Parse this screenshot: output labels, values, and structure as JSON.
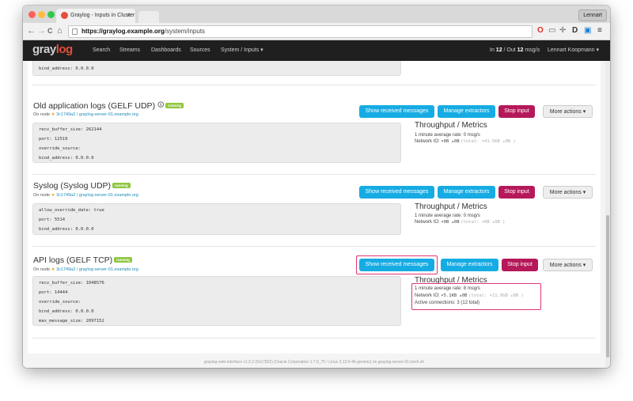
{
  "browser": {
    "tab_title": "Graylog - Inputs in Cluster",
    "tab_close": "×",
    "user_button": "Lennart",
    "url_host": "https://graylog.example.org",
    "url_path": "/system/inputs",
    "back": "←",
    "forward": "→",
    "reload": "C",
    "home": "⌂"
  },
  "navbar": {
    "logo_a": "gray",
    "logo_b": "log",
    "items": [
      "Search",
      "Streams",
      "Dashboards",
      "Sources",
      "System / Inputs ▾"
    ],
    "throughput_prefix": "In ",
    "throughput_in": "12",
    "throughput_mid": " / Out ",
    "throughput_out": "12",
    "throughput_suffix": " msg/s",
    "user": "Lennart Koopmann ▾"
  },
  "top_partial": {
    "line": "bind_address: 0.0.0.0"
  },
  "actions": {
    "show_received": "Show received messages",
    "manage_extractors": "Manage extractors",
    "stop_input": "Stop input",
    "more_actions": "More actions ▾"
  },
  "inputs": [
    {
      "title": "Old application logs (GELF UDP)",
      "badge": "running",
      "node_prefix": "On node ",
      "node_star": "★",
      "node_link": "3c1749a2 / graylog-server-01.example.org",
      "config": [
        "recv_buffer_size: 262144",
        "port: 12519",
        "override_source:",
        "bind_address: 0.0.0.0"
      ],
      "metrics_title": "Throughput / Metrics",
      "rate": "1 minute average rate: 0 msg/s",
      "netio_label": "Network IO: ",
      "netio_value": "▾0B ▴0B",
      "netio_total": "(total: ▾41.5KB ▴0B )"
    },
    {
      "title": "Syslog (Syslog UDP)",
      "badge": "running",
      "node_prefix": "On node ",
      "node_star": "★",
      "node_link": "3c1749a2 / graylog-server-01.example.org",
      "config": [
        "allow_override_date: true",
        "port: 5514",
        "bind_address: 0.0.0.0"
      ],
      "metrics_title": "Throughput / Metrics",
      "rate": "1 minute average rate: 0 msg/s",
      "netio_label": "Network IO: ",
      "netio_value": "▾0B ▴0B",
      "netio_total": "(total: ▾0B ▴0B )"
    },
    {
      "title": "API logs (GELF TCP)",
      "badge": "running",
      "node_prefix": "On node ",
      "node_star": "★",
      "node_link": "3c1749a2 / graylog-server-01.example.org",
      "config": [
        "recv_buffer_size: 1048576",
        "port: 14444",
        "override_source:",
        "bind_address: 0.0.0.0",
        "max_message_size: 2097152"
      ],
      "metrics_title": "Throughput / Metrics",
      "rate": "1 minute average rate: 8 msg/s",
      "netio_label": "Network IO: ",
      "netio_value": "▾5.1KB ▴0B",
      "netio_total": "(total: ▾11.9GB ▴0B )",
      "connections": "Active connections: 3 (12 total)"
    }
  ],
  "footer": "graylog-web-interface v1.2.2 (91c7822) (Oracle Corporation 1.7.0_75 / Linux 3.13.0-46-generic) on graylog-server-01.torch.sh",
  "colors": {
    "accent_blue": "#16ace3",
    "stop_red": "#b5195a",
    "running_green": "#8ec63f",
    "highlight_pink": "#e0357a"
  }
}
